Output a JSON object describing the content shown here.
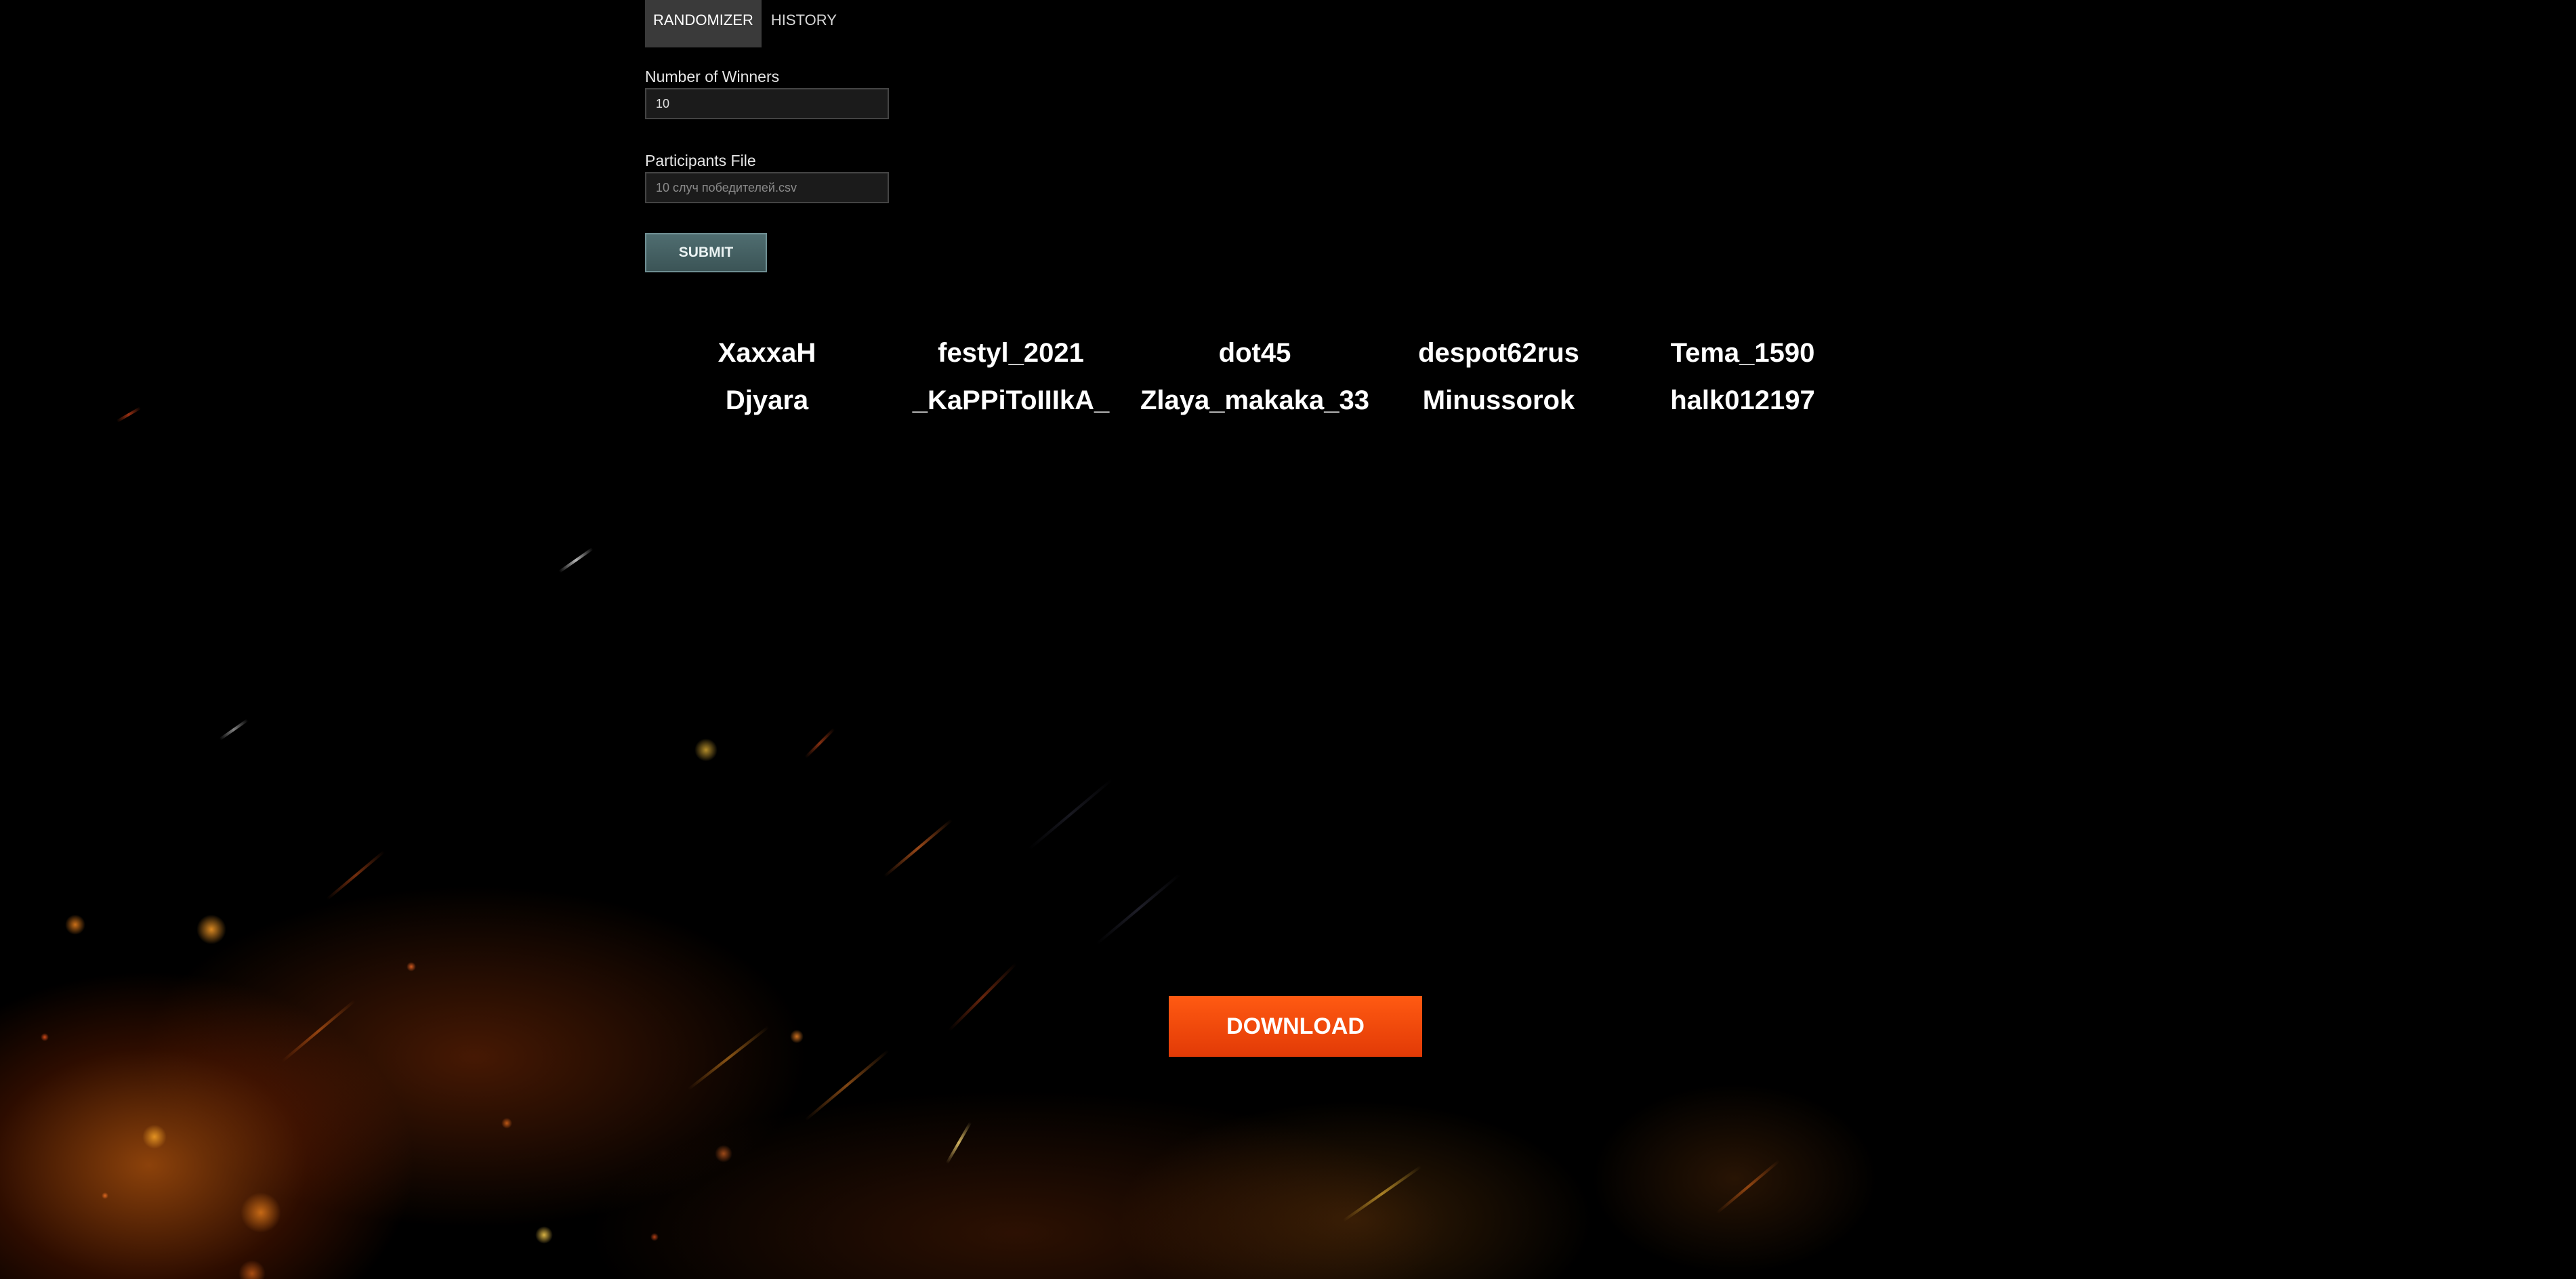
{
  "tabs": {
    "randomizer": "RANDOMIZER",
    "history": "HISTORY"
  },
  "form": {
    "winners_label": "Number of Winners",
    "winners_value": "10",
    "participants_label": "Participants File",
    "participants_file": "10 случ победителей.csv",
    "submit_label": "SUBMIT"
  },
  "winners": [
    "XaxxaH",
    "festyl_2021",
    "dot45",
    "despot62rus",
    "Tema_1590",
    "Djyara",
    "_KaPPiToIIIkA_",
    "Zlaya_makaka_33",
    "Minussorok",
    "halk012197"
  ],
  "download_label": "DOWNLOAD",
  "colors": {
    "background": "#000000",
    "active_tab": "#3a3a3a",
    "submit": "#4f6d70",
    "download": "#ff4d0d",
    "text": "#ffffff"
  }
}
